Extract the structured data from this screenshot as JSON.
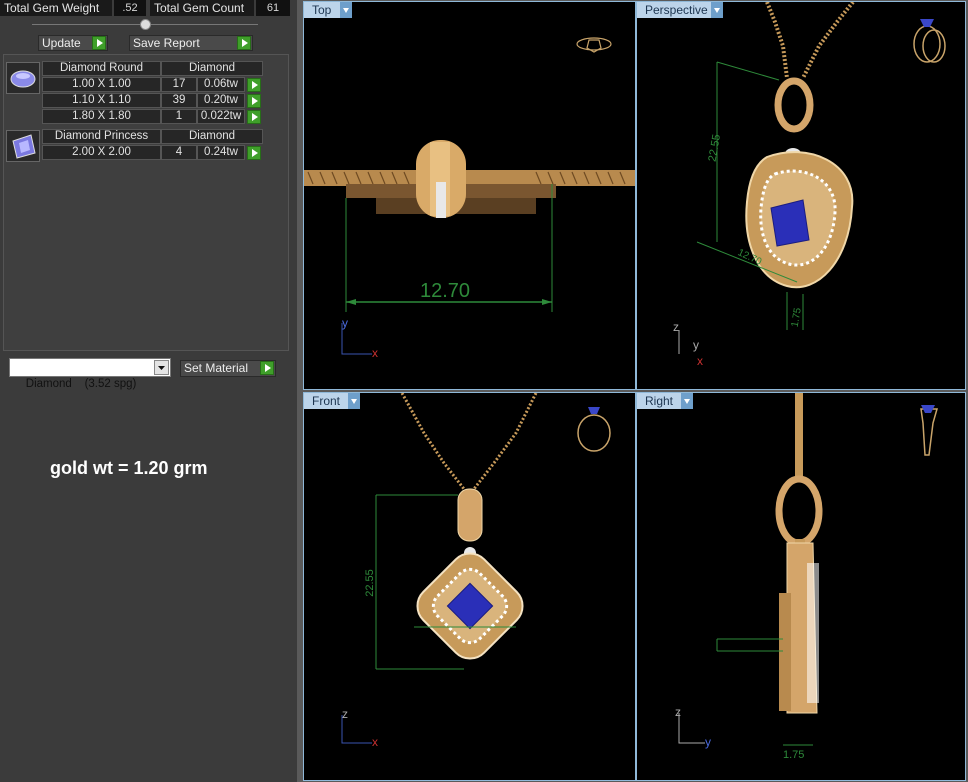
{
  "stats": {
    "weight_label": "Total Gem Weight",
    "weight_value": ".52",
    "count_label": "Total Gem Count",
    "count_value": "61"
  },
  "toolbar": {
    "update_label": "Update",
    "save_report_label": "Save Report"
  },
  "gems": [
    {
      "shape": "Diamond Round",
      "material": "Diamond",
      "rows": [
        {
          "size": "1.00 X 1.00",
          "count": "17",
          "weight": "0.06tw"
        },
        {
          "size": "1.10 X 1.10",
          "count": "39",
          "weight": "0.20tw"
        },
        {
          "size": "1.80 X 1.80",
          "count": "1",
          "weight": "0.022tw"
        }
      ]
    },
    {
      "shape": "Diamond Princess",
      "material": "Diamond",
      "rows": [
        {
          "size": "2.00 X 2.00",
          "count": "4",
          "weight": "0.24tw"
        }
      ]
    }
  ],
  "material_select": {
    "value": "Diamond    (3.52 spg)"
  },
  "set_material_label": "Set Material",
  "gold_weight_note": "gold wt = 1.20 grm",
  "viewports": {
    "top": {
      "label": "Top",
      "dimension": "12.70",
      "axis_a": "y",
      "axis_b": "x"
    },
    "perspective": {
      "label": "Perspective",
      "dim_height": "22.55",
      "dim_width": "12.70",
      "dim_depth": "1.75",
      "axis_a": "z",
      "axis_b": "y",
      "axis_c": "x"
    },
    "front": {
      "label": "Front",
      "dimension": "22.55",
      "axis_a": "z",
      "axis_b": "x"
    },
    "right": {
      "label": "Right",
      "dimension": "1.75",
      "axis_a": "z",
      "axis_b": "y"
    }
  },
  "colors": {
    "gold": "#d4a56a",
    "gold_dark": "#8a6032",
    "sapphire": "#2a2fb8",
    "dimension_line": "#2e8a3a",
    "viewport_tab": "#bcd4ea",
    "play_button": "#3f9f2a"
  }
}
